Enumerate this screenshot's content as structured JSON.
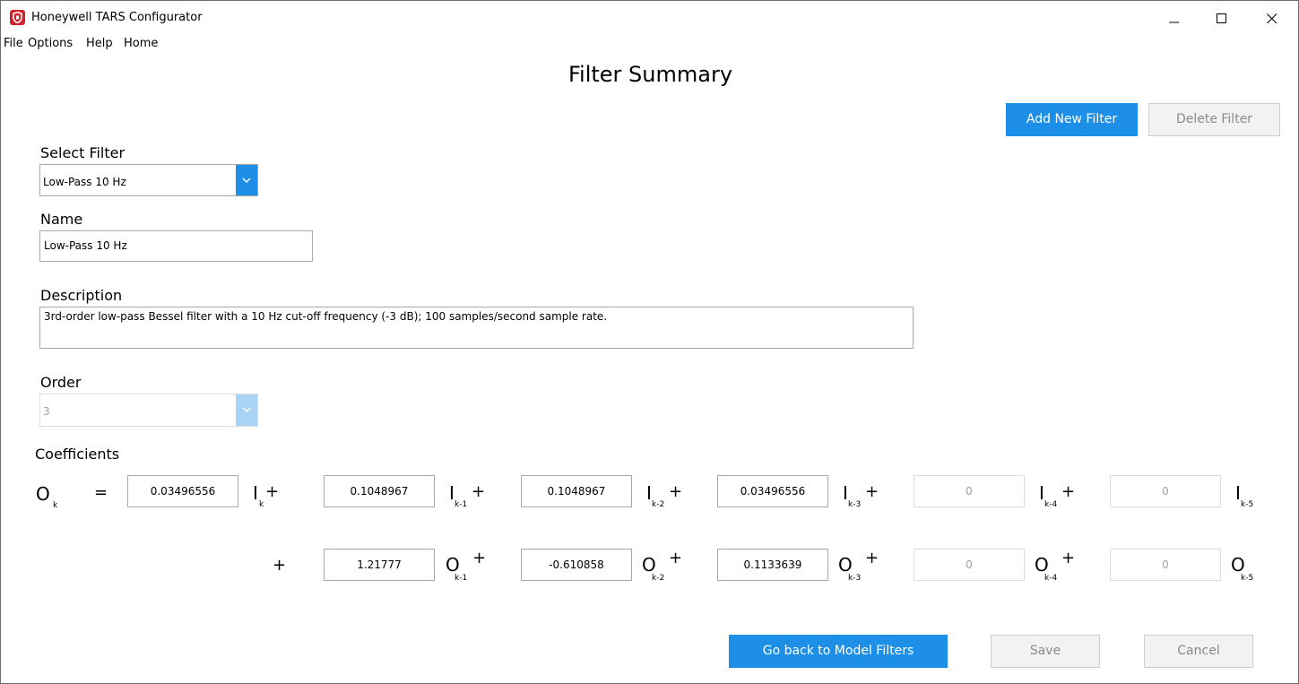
{
  "window": {
    "title": "Honeywell TARS Configurator"
  },
  "menu": {
    "file": "File",
    "options": "Options",
    "help": "Help",
    "home": "Home"
  },
  "page_title": "Filter Summary",
  "buttons": {
    "add_new_filter": "Add New Filter",
    "delete_filter": "Delete Filter",
    "go_back": "Go back to Model Filters",
    "save": "Save",
    "cancel": "Cancel"
  },
  "select_filter": {
    "label": "Select Filter",
    "value": "Low-Pass 10 Hz"
  },
  "name": {
    "label": "Name",
    "value": "Low-Pass 10 Hz"
  },
  "description": {
    "label": "Description",
    "value": "3rd-order low-pass Bessel filter with a 10 Hz cut-off frequency (-3 dB); 100 samples/second sample rate."
  },
  "order": {
    "label": "Order",
    "value": "3"
  },
  "coefficients": {
    "label": "Coefficients",
    "lhs": {
      "symbol": "O",
      "sub": "k",
      "equals": "="
    },
    "plus": "+",
    "input_row": {
      "values": [
        "0.03496556",
        "0.1048967",
        "0.1048967",
        "0.03496556",
        "0",
        "0"
      ],
      "symbol": "I",
      "subs": [
        "k",
        "k-1",
        "k-2",
        "k-3",
        "k-4",
        "k-5"
      ]
    },
    "output_row": {
      "values": [
        "1.21777",
        "-0.610858",
        "0.1133639",
        "0",
        "0"
      ],
      "symbol": "O",
      "subs": [
        "k-1",
        "k-2",
        "k-3",
        "k-4",
        "k-5"
      ]
    }
  },
  "colors": {
    "accent": "#1e8fe6",
    "app_icon": "#d6202b"
  }
}
